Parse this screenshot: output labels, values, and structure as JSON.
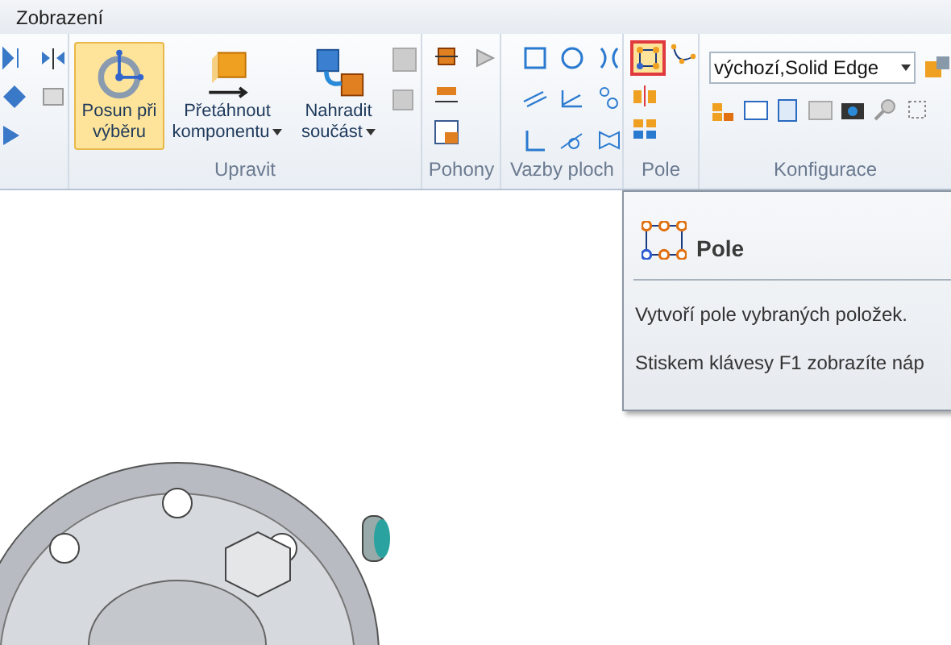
{
  "menu_tab": "Zobrazení",
  "groups": [
    {
      "label": "Upravit",
      "buttons": [
        {
          "label": "Posun při výběru",
          "selected": true,
          "dropdown": false
        },
        {
          "label": "Přetáhnout komponentu",
          "selected": false,
          "dropdown": true
        },
        {
          "label": "Nahradit součást",
          "selected": false,
          "dropdown": true
        }
      ]
    },
    {
      "label": "Pohony"
    },
    {
      "label": "Vazby ploch"
    },
    {
      "label": "Pole",
      "pattern_button_highlighted": true
    },
    {
      "label": "Konfigurace",
      "dropdown_value": "výchozí,Solid Edge"
    }
  ],
  "tooltip": {
    "title": "Pole",
    "description": "Vytvoří pole vybraných položek.",
    "help": "Stiskem klávesy F1 zobrazíte náp"
  }
}
